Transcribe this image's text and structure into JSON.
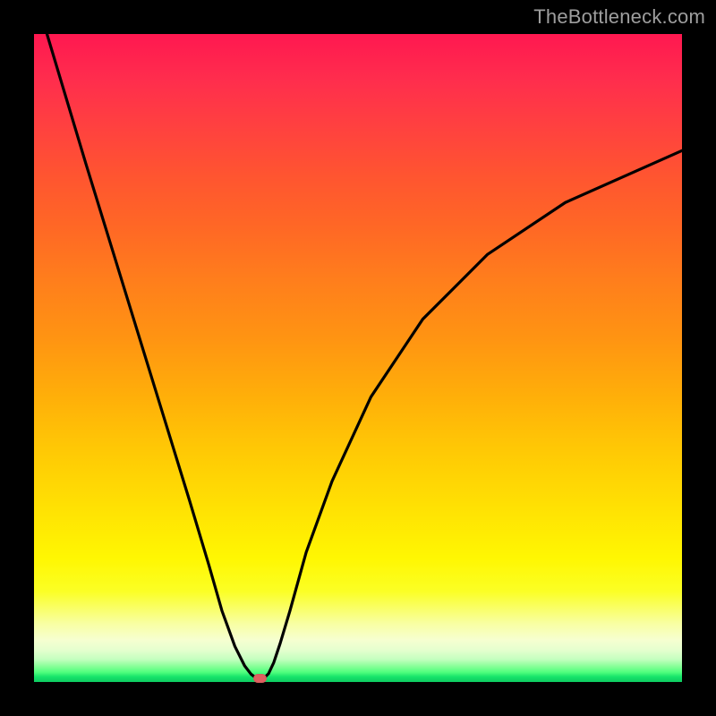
{
  "watermark": "TheBottleneck.com",
  "chart_data": {
    "type": "line",
    "title": "",
    "xlabel": "",
    "ylabel": "",
    "xlim": [
      0,
      100
    ],
    "ylim": [
      0,
      100
    ],
    "curve": {
      "x": [
        2,
        5,
        8,
        12,
        16,
        20,
        24,
        27,
        29,
        31,
        32.5,
        33.5,
        34.3,
        34.8,
        35.5,
        36.2,
        37,
        38,
        39.5,
        42,
        46,
        52,
        60,
        70,
        82,
        100
      ],
      "y": [
        100,
        90,
        80,
        67,
        54,
        41,
        28,
        18,
        11,
        5.5,
        2.5,
        1.2,
        0.6,
        0.55,
        0.6,
        1.3,
        3,
        6,
        11,
        20,
        31,
        44,
        56,
        66,
        74,
        82
      ]
    },
    "minimum_marker": {
      "x": 34.8,
      "y": 0.55
    },
    "background_gradient": {
      "top_color": "#ff1850",
      "mid_color": "#ffe103",
      "bottom_color": "#0ecc61"
    }
  },
  "colors": {
    "frame": "#000000",
    "curve": "#000000",
    "marker": "#e06060",
    "watermark": "#9e9e9e"
  }
}
